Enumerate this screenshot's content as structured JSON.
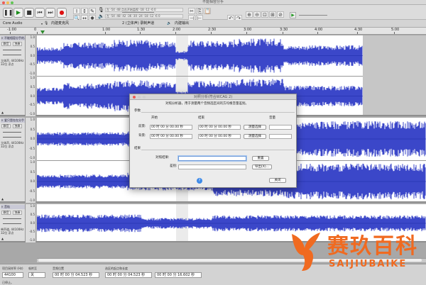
{
  "window": {
    "title": "不能相容分手"
  },
  "toolbar": {
    "record_meter_label": "左 -54 -48 点击开始监视 -18 -12 -6 0",
    "play_meter_label": "左 -54 -48 -42 -36 -30 -24 -18 -12 -6 0",
    "tools": [
      {
        "icon": "selection-tool-icon",
        "glyph": "I"
      },
      {
        "icon": "envelope-tool-icon",
        "glyph": "↕"
      },
      {
        "icon": "draw-tool-icon",
        "glyph": "✎"
      },
      {
        "icon": "zoom-tool-icon",
        "glyph": "🔍"
      },
      {
        "icon": "timeshift-tool-icon",
        "glyph": "↔"
      },
      {
        "icon": "multi-tool-icon",
        "glyph": "✱"
      }
    ],
    "edit_icons": [
      {
        "icon": "cut-icon",
        "glyph": "✂"
      },
      {
        "icon": "copy-icon",
        "glyph": "⎘"
      },
      {
        "icon": "paste-icon",
        "glyph": "📋"
      },
      {
        "icon": "trim-icon",
        "glyph": "⊣"
      },
      {
        "icon": "silence-icon",
        "glyph": "⊢"
      },
      {
        "icon": "undo-icon",
        "glyph": "↶"
      },
      {
        "icon": "redo-icon",
        "glyph": "↷"
      },
      {
        "icon": "zoom-in-icon",
        "glyph": "⊕"
      },
      {
        "icon": "zoom-out-icon",
        "glyph": "⊖"
      },
      {
        "icon": "fit-selection-icon",
        "glyph": "⊡"
      },
      {
        "icon": "fit-project-icon",
        "glyph": "⊞"
      },
      {
        "icon": "zoom-toggle-icon",
        "glyph": "⊘"
      }
    ]
  },
  "devices": {
    "host": "Core Audio",
    "recording": "内建麦克风",
    "channels": "2 (立体声) 录制声道",
    "playback": "内建输出"
  },
  "ruler": {
    "labels": [
      "-1:00",
      "0",
      "1:00",
      "1:30",
      "2:00",
      "2:30",
      "3:00",
      "3:30",
      "4:00",
      "4:30",
      "5:00"
    ]
  },
  "tracks": [
    {
      "name": "不能相容分手的...",
      "info": "立体声, 44100Hz\n32位 浮点",
      "mute": "静音",
      "solo": "独奏",
      "scale": [
        "1.0",
        "0.5",
        "0.0",
        "-0.5",
        "-1.0"
      ]
    },
    {
      "name": "爱只是在在分手",
      "info": "立体声, 44100Hz\n32位 浮点",
      "mute": "静音",
      "solo": "独奏",
      "scale": [
        "1.0",
        "0.5",
        "0.0",
        "-0.5",
        "-1.0"
      ]
    },
    {
      "name": "音轨",
      "info": "单声道, 44100Hz\n32位 浮点",
      "mute": "静音",
      "solo": "独奏",
      "scale": [
        "1.0",
        "0.5",
        "0.0",
        "-0.5",
        "-1.0"
      ]
    }
  ],
  "dialog": {
    "title": "对照分析(符合WCAG 2)",
    "description": "对照分析器，用于测量两个音频选区间的方均根音量差别。",
    "params_label": "参数",
    "col_start": "开始",
    "col_end": "结束",
    "col_volume": "音量",
    "foreground_label": "前景:",
    "background_label": "背景:",
    "time_zero": "00 时 00 分 00.00 秒",
    "measure_btn": "测量选择",
    "result_label": "结果",
    "contrast_label": "对照结果:",
    "difference_label": "差别:",
    "reset_btn": "重置",
    "export_btn": "导出(X)...",
    "help_icon": "?",
    "close_btn": "关闭"
  },
  "bottom": {
    "rate_label": "项目采样率 (Hz)",
    "rate": "44100",
    "snap_label": "吸附至",
    "snap": "关",
    "pos_label": "音频位置",
    "pos": "00 时 00 分 04.523 秒",
    "sel_label": "选区的起点和长度",
    "sel_start": "00 时 00 分 04.523 秒",
    "sel_end": "00 时 00 分 16.602 秒",
    "status": "已停止。"
  },
  "watermark": {
    "cn": "赛玖百科",
    "en": "SAIJIUBAIKE"
  },
  "colors": {
    "wave": "#3b47c9",
    "wave_dark": "#1d2aa8",
    "selection": "#ebebeb",
    "accent": "#f06a20"
  }
}
